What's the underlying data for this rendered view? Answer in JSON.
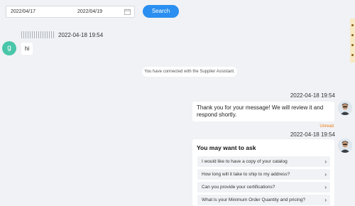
{
  "filter": {
    "start_date": "2022/04/17",
    "end_date": "2022/04/19",
    "search_label": "Search"
  },
  "chat": {
    "incoming": {
      "avatar_letter": "g",
      "time": "2022-04-18 19:54",
      "text": "hi"
    },
    "system_notice": "You have connected with the Supplier Assistant.",
    "reply": {
      "time": "2022-04-18 19:54",
      "text": "Thank you for your message! We will review it and respond shortly.",
      "status": "Unread"
    },
    "suggestions": {
      "time": "2022-04-18 19:54",
      "title": "You may want to ask",
      "items": [
        "I would like to have a copy of your catalog",
        "How long will it take to ship to my address?",
        "Can you provide your certifications?",
        "What is your Minimum Order Quantity and pricing?"
      ]
    }
  },
  "colors": {
    "accent": "#2a8ff0",
    "avatar_green": "#49c6a9",
    "unread_orange": "#f07a16"
  }
}
